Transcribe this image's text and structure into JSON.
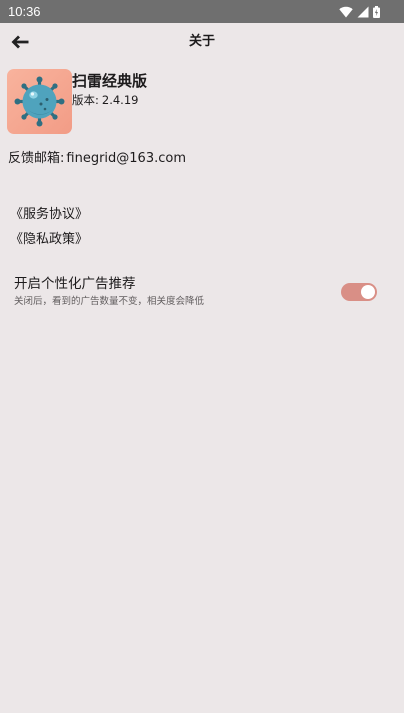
{
  "status_bar": {
    "time": "10:36"
  },
  "app_bar": {
    "title": "关于",
    "back_icon": "arrow-left-icon"
  },
  "app_info": {
    "name": "扫雷经典版",
    "version_label": "版本:",
    "version_value": "2.4.19"
  },
  "feedback": {
    "label": "反馈邮箱:",
    "value": "finegrid@163.com"
  },
  "links": {
    "service": "《服务协议》",
    "privacy": "《隐私政策》"
  },
  "personalized_ads": {
    "title": "开启个性化广告推荐",
    "description": "关闭后，看到的广告数量不变，相关度会降低",
    "enabled": true
  },
  "colors": {
    "background": "#ece7e8",
    "status_bar": "#6f6f6f",
    "toggle_on": "#d98f86",
    "icon_bg": "#f29c86"
  }
}
